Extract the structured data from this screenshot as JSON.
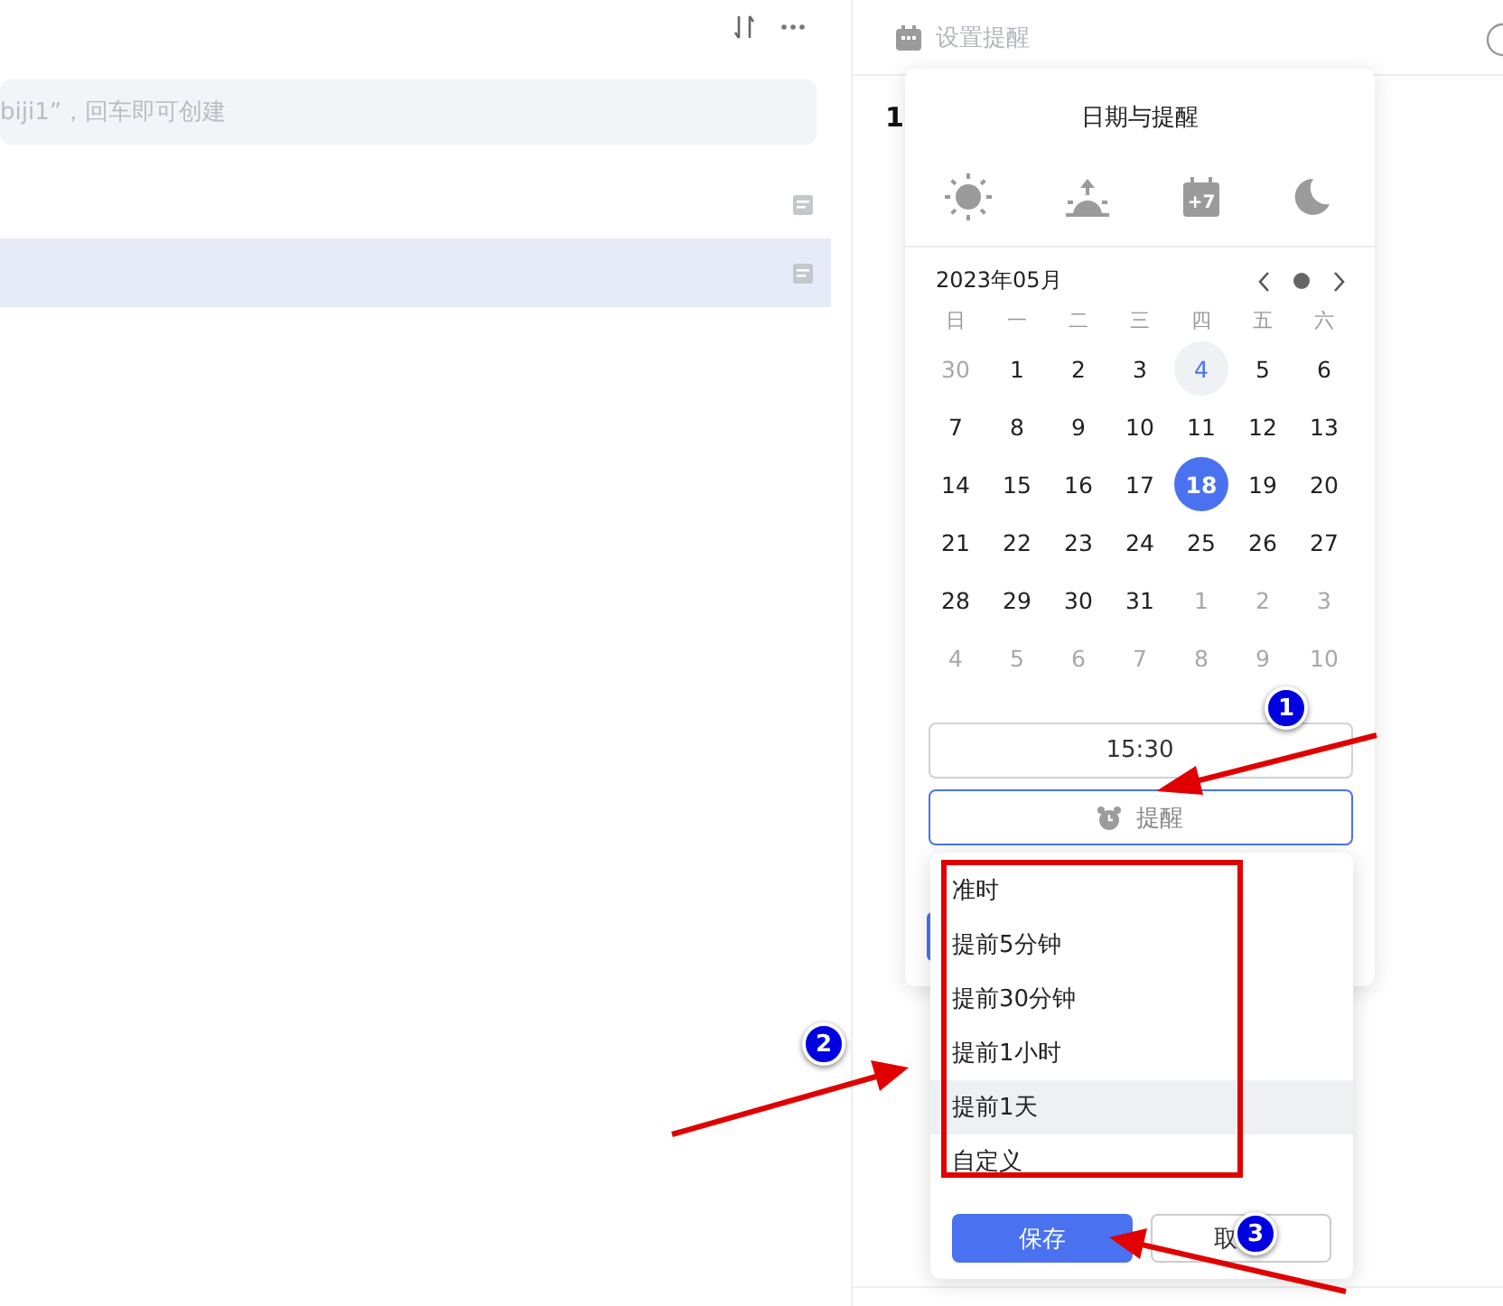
{
  "list_panel": {
    "new_note_placeholder": "biji1”，回车即可创建",
    "rows": [
      {
        "selected": false
      },
      {
        "selected": true
      }
    ]
  },
  "detail_panel": {
    "reminder_placeholder": "设置提醒",
    "title_fragment": "1"
  },
  "date_popover": {
    "title": "日期与提醒",
    "quick_options": [
      {
        "kind": "sun"
      },
      {
        "kind": "sunrise"
      },
      {
        "kind": "week",
        "label": "+7"
      },
      {
        "kind": "moon"
      }
    ],
    "month": "2023年05月",
    "weekdays": [
      "日",
      "一",
      "二",
      "三",
      "四",
      "五",
      "六"
    ],
    "weeks": [
      [
        {
          "day": "30",
          "muted": true,
          "today": false,
          "selected": false
        },
        {
          "day": "1",
          "muted": false,
          "today": false,
          "selected": false
        },
        {
          "day": "2",
          "muted": false,
          "today": false,
          "selected": false
        },
        {
          "day": "3",
          "muted": false,
          "today": false,
          "selected": false
        },
        {
          "day": "4",
          "muted": false,
          "today": true,
          "selected": false
        },
        {
          "day": "5",
          "muted": false,
          "today": false,
          "selected": false
        },
        {
          "day": "6",
          "muted": false,
          "today": false,
          "selected": false
        }
      ],
      [
        {
          "day": "7",
          "muted": false,
          "today": false,
          "selected": false
        },
        {
          "day": "8",
          "muted": false,
          "today": false,
          "selected": false
        },
        {
          "day": "9",
          "muted": false,
          "today": false,
          "selected": false
        },
        {
          "day": "10",
          "muted": false,
          "today": false,
          "selected": false
        },
        {
          "day": "11",
          "muted": false,
          "today": false,
          "selected": false
        },
        {
          "day": "12",
          "muted": false,
          "today": false,
          "selected": false
        },
        {
          "day": "13",
          "muted": false,
          "today": false,
          "selected": false
        }
      ],
      [
        {
          "day": "14",
          "muted": false,
          "today": false,
          "selected": false
        },
        {
          "day": "15",
          "muted": false,
          "today": false,
          "selected": false
        },
        {
          "day": "16",
          "muted": false,
          "today": false,
          "selected": false
        },
        {
          "day": "17",
          "muted": false,
          "today": false,
          "selected": false
        },
        {
          "day": "18",
          "muted": false,
          "today": false,
          "selected": true
        },
        {
          "day": "19",
          "muted": false,
          "today": false,
          "selected": false
        },
        {
          "day": "20",
          "muted": false,
          "today": false,
          "selected": false
        }
      ],
      [
        {
          "day": "21",
          "muted": false,
          "today": false,
          "selected": false
        },
        {
          "day": "22",
          "muted": false,
          "today": false,
          "selected": false
        },
        {
          "day": "23",
          "muted": false,
          "today": false,
          "selected": false
        },
        {
          "day": "24",
          "muted": false,
          "today": false,
          "selected": false
        },
        {
          "day": "25",
          "muted": false,
          "today": false,
          "selected": false
        },
        {
          "day": "26",
          "muted": false,
          "today": false,
          "selected": false
        },
        {
          "day": "27",
          "muted": false,
          "today": false,
          "selected": false
        }
      ],
      [
        {
          "day": "28",
          "muted": false,
          "today": false,
          "selected": false
        },
        {
          "day": "29",
          "muted": false,
          "today": false,
          "selected": false
        },
        {
          "day": "30",
          "muted": false,
          "today": false,
          "selected": false
        },
        {
          "day": "31",
          "muted": false,
          "today": false,
          "selected": false
        },
        {
          "day": "1",
          "muted": true,
          "today": false,
          "selected": false
        },
        {
          "day": "2",
          "muted": true,
          "today": false,
          "selected": false
        },
        {
          "day": "3",
          "muted": true,
          "today": false,
          "selected": false
        }
      ],
      [
        {
          "day": "4",
          "muted": true,
          "today": false,
          "selected": false
        },
        {
          "day": "5",
          "muted": true,
          "today": false,
          "selected": false
        },
        {
          "day": "6",
          "muted": true,
          "today": false,
          "selected": false
        },
        {
          "day": "7",
          "muted": true,
          "today": false,
          "selected": false
        },
        {
          "day": "8",
          "muted": true,
          "today": false,
          "selected": false
        },
        {
          "day": "9",
          "muted": true,
          "today": false,
          "selected": false
        },
        {
          "day": "10",
          "muted": true,
          "today": false,
          "selected": false
        }
      ]
    ],
    "time": "15:30",
    "reminder_button": "提醒"
  },
  "reminder_menu": {
    "options": [
      {
        "label": "准时",
        "selected": false
      },
      {
        "label": "提前5分钟",
        "selected": false
      },
      {
        "label": "提前30分钟",
        "selected": false
      },
      {
        "label": "提前1小时",
        "selected": false
      },
      {
        "label": "提前1天",
        "selected": true
      },
      {
        "label": "自定义",
        "selected": false
      }
    ],
    "save_button": "保存",
    "cancel_button": "取"
  },
  "annotations": {
    "badges": [
      "1",
      "2",
      "3"
    ]
  }
}
